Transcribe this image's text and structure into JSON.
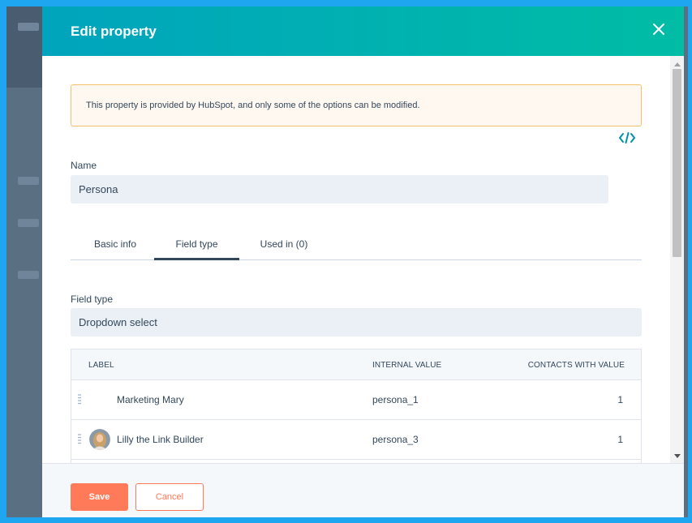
{
  "modal": {
    "title": "Edit property"
  },
  "alert": {
    "text": "This property is provided by HubSpot, and only some of the options can be modified."
  },
  "name_field": {
    "label": "Name",
    "value": "Persona"
  },
  "tabs": [
    {
      "label": "Basic info",
      "active": false
    },
    {
      "label": "Field type",
      "active": true
    },
    {
      "label": "Used in (0)",
      "active": false
    }
  ],
  "field_type": {
    "label": "Field type",
    "value": "Dropdown select"
  },
  "options_table": {
    "headers": {
      "label": "LABEL",
      "internal_value": "INTERNAL VALUE",
      "contacts_with_value": "CONTACTS WITH VALUE"
    },
    "rows": [
      {
        "label": "Marketing Mary",
        "internal_value": "persona_1",
        "contacts": "1",
        "avatar": false
      },
      {
        "label": "Lilly the Link Builder",
        "internal_value": "persona_3",
        "contacts": "1",
        "avatar": true
      }
    ]
  },
  "footer": {
    "save_label": "Save",
    "cancel_label": "Cancel"
  },
  "colors": {
    "header_gradient_start": "#00a4bd",
    "header_gradient_end": "#00bda5",
    "primary_button": "#ff7a59",
    "text": "#33475b",
    "alert_border": "#f5c26b"
  },
  "icons": {
    "close": "close-icon",
    "code": "code-icon",
    "drag": "drag-handle-icon"
  }
}
